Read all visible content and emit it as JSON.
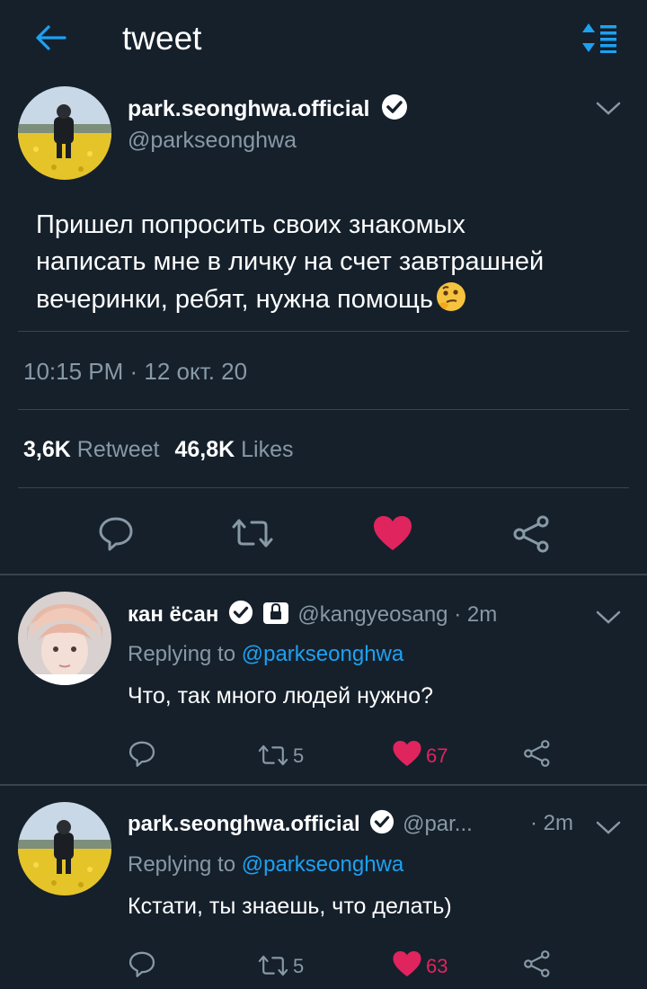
{
  "header": {
    "title": "tweet"
  },
  "main_tweet": {
    "display_name": "park.seonghwa.official",
    "handle": "@parkseonghwa",
    "text_line1": "Пришел попросить своих знакомых",
    "text_line2": "написать мне в личку на счет завтрашней",
    "text_line3": "вечеринки, ребят, нужна помощь",
    "timestamp": "10:15 PM · 12 окт. 20",
    "retweet_count": "3,6K",
    "retweet_label": "Retweet",
    "likes_count": "46,8K",
    "likes_label": "Likes"
  },
  "replies": [
    {
      "display_name": "кан ёсан",
      "handle": "@kangyeosang",
      "time": "· 2m",
      "replying_prefix": "Replying to",
      "replying_to": "@parkseonghwa",
      "text": "Что, так много людей нужно?",
      "retweets": "5",
      "likes": "67"
    },
    {
      "display_name": "park.seonghwa.official",
      "handle": "@par...",
      "time": "· 2m",
      "replying_prefix": "Replying to",
      "replying_to": "@parkseonghwa",
      "text": "Кстати, ты знаешь, что делать)",
      "retweets": "5",
      "likes": "63"
    }
  ],
  "colors": {
    "background": "#15202b",
    "accent": "#1da1f2",
    "like": "#e0245e",
    "muted": "#8899a6"
  },
  "icons": [
    "back-arrow-icon",
    "sort-icon",
    "verified-icon",
    "lock-icon",
    "chevron-down-icon",
    "reply-icon",
    "retweet-icon",
    "heart-icon",
    "share-icon",
    "thinking-emoji"
  ]
}
